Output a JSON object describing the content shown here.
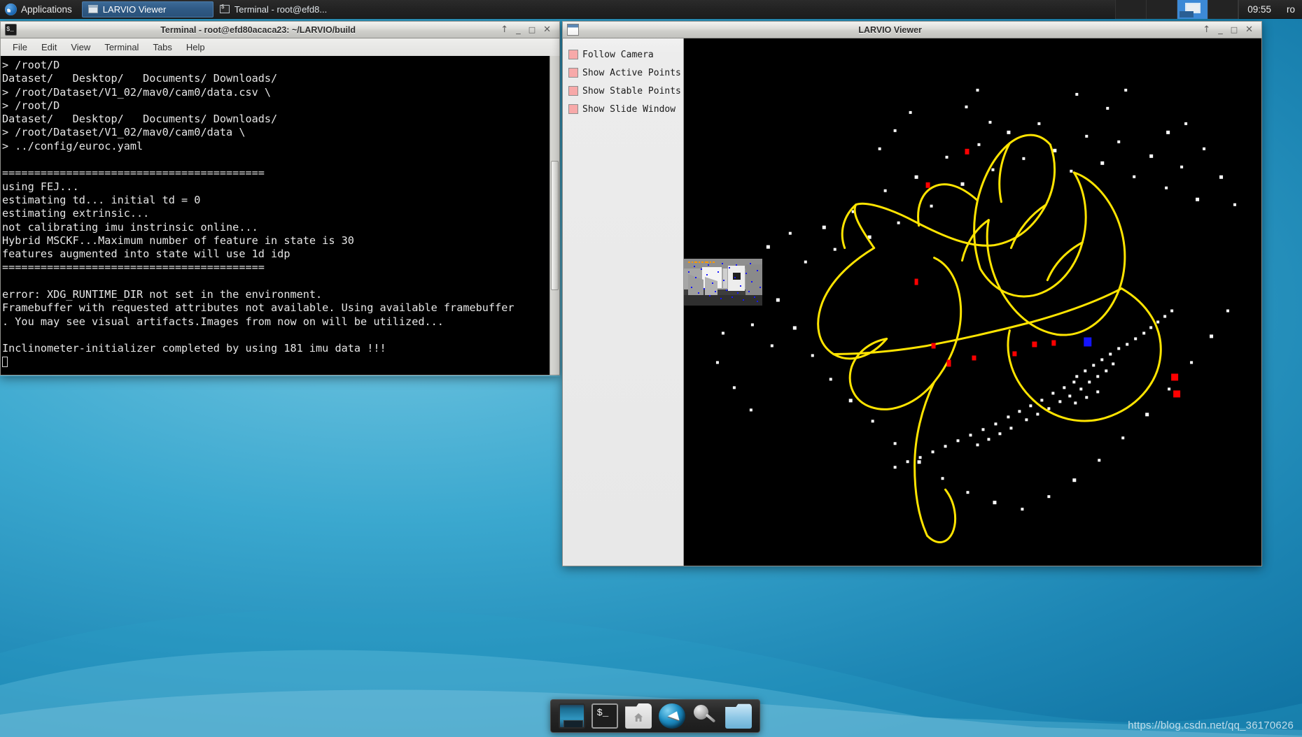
{
  "desktop": {
    "watermark": "https://blog.csdn.net/qq_36170626",
    "wallpaper_color": "#1d86b4"
  },
  "toppanel": {
    "applications_label": "Applications",
    "applications_icon": "xfce-mouse-icon",
    "tasks": [
      {
        "label": "LARVIO Viewer",
        "icon": "window-icon",
        "active": true
      },
      {
        "label": "Terminal - root@efd8...",
        "icon": "terminal-icon",
        "active": false
      }
    ],
    "workspaces": [
      {
        "name": "workspace-1",
        "active": false
      },
      {
        "name": "workspace-2",
        "active": false
      },
      {
        "name": "workspace-3",
        "active": true
      },
      {
        "name": "workspace-4",
        "active": false
      }
    ],
    "clock": "09:55",
    "user": "ro"
  },
  "terminal": {
    "title": "Terminal - root@efd80acaca23: ~/LARVIO/build",
    "icon": "terminal-icon",
    "window_buttons": {
      "shade": "↑",
      "minimize": "_",
      "maximize": "□",
      "close": "✕"
    },
    "menu": [
      "File",
      "Edit",
      "View",
      "Terminal",
      "Tabs",
      "Help"
    ],
    "output": "> /root/D\nDataset/   Desktop/   Documents/ Downloads/\n> /root/Dataset/V1_02/mav0/cam0/data.csv \\\n> /root/D\nDataset/   Desktop/   Documents/ Downloads/\n> /root/Dataset/V1_02/mav0/cam0/data \\\n> ../config/euroc.yaml\n\n=========================================\nusing FEJ...\nestimating td... initial td = 0\nestimating extrinsic...\nnot calibrating imu instrinsic online...\nHybrid MSCKF...Maximum number of feature in state is 30\nfeatures augmented into state will use 1d idp\n=========================================\n\nerror: XDG_RUNTIME_DIR not set in the environment.\nFramebuffer with requested attributes not available. Using available framebuffer\n. You may see visual artifacts.Images from now on will be utilized...\n\nInclinometer-initializer completed by using 181 imu data !!!\n"
  },
  "viewer": {
    "title": "LARVIO Viewer",
    "icon": "window-icon",
    "window_buttons": {
      "shade": "↑",
      "minimize": "_",
      "maximize": "□",
      "close": "✕"
    },
    "checkboxes": [
      {
        "label": "Follow Camera",
        "checked": true,
        "color": "#f7a9a9"
      },
      {
        "label": "Show Active Points",
        "checked": true,
        "color": "#f7a9a9"
      },
      {
        "label": "Show Stable Points",
        "checked": true,
        "color": "#f7a9a9"
      },
      {
        "label": "Show Slide Window",
        "checked": true,
        "color": "#f7a9a9"
      }
    ],
    "render": {
      "background": "#000000",
      "trajectory_color": "#ffe400",
      "map_point_color": "#ffffff",
      "current_pose_color": "#1414ff",
      "marker_color": "#ff0000",
      "camera_preview": "grayscale-room-with-feature-points"
    }
  },
  "dock": {
    "items": [
      {
        "name": "show-desktop",
        "icon": "desktop-icon"
      },
      {
        "name": "terminal",
        "icon": "terminal-icon"
      },
      {
        "name": "file-manager-home",
        "icon": "home-folder-icon"
      },
      {
        "name": "web-browser",
        "icon": "globe-icon"
      },
      {
        "name": "search",
        "icon": "magnifier-icon"
      },
      {
        "name": "file-manager",
        "icon": "folder-icon"
      }
    ]
  }
}
